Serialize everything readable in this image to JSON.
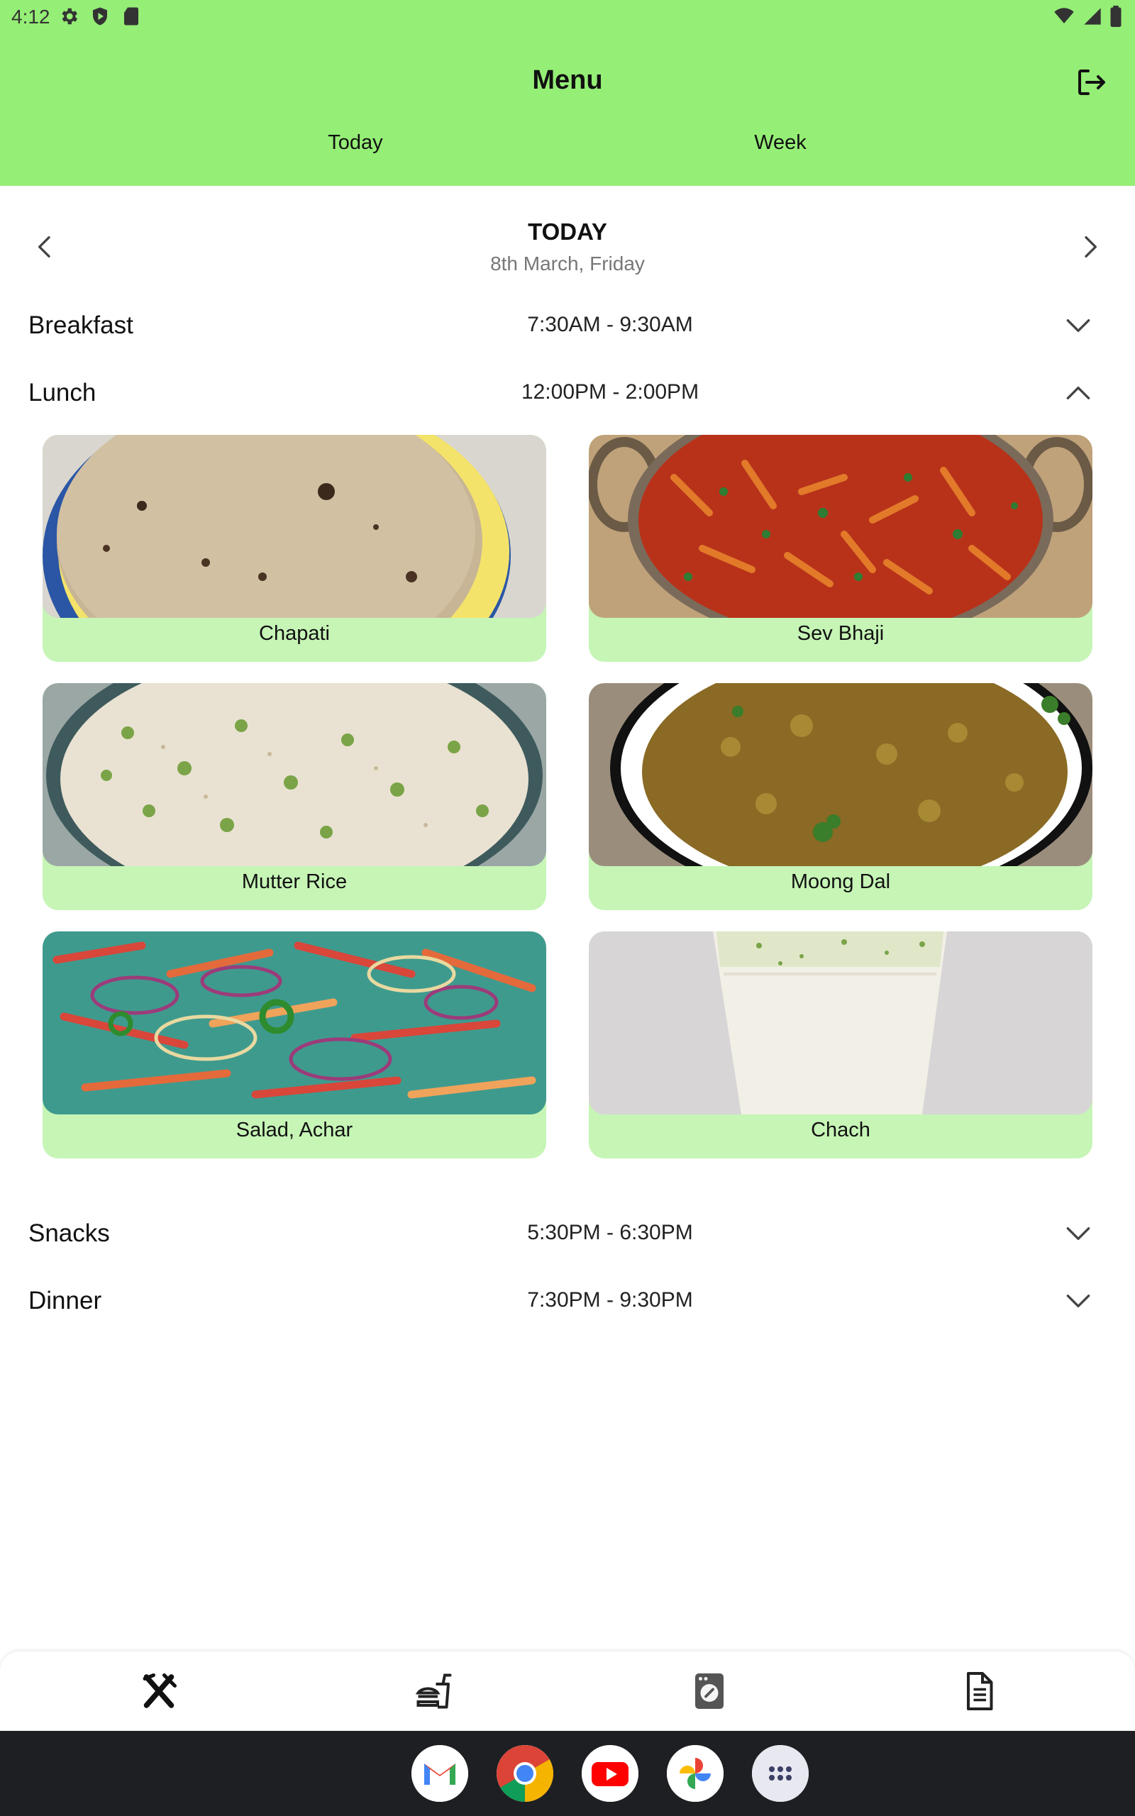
{
  "status_bar": {
    "time": "4:12"
  },
  "header": {
    "title": "Menu",
    "tabs": [
      {
        "label": "Today",
        "active": true
      },
      {
        "label": "Week",
        "active": false
      }
    ],
    "colors": {
      "header_bg": "#95ee76",
      "card_bg": "#c6f5b6"
    }
  },
  "date_nav": {
    "title": "TODAY",
    "subtitle": "8th March, Friday"
  },
  "meals": [
    {
      "name": "Breakfast",
      "time": "7:30AM - 9:30AM",
      "expanded": false
    },
    {
      "name": "Lunch",
      "time": "12:00PM - 2:00PM",
      "expanded": true,
      "items": [
        "Chapati",
        "Sev Bhaji",
        "Mutter Rice",
        "Moong Dal",
        "Salad, Achar",
        "Chach"
      ]
    },
    {
      "name": "Snacks",
      "time": "5:30PM - 6:30PM",
      "expanded": false
    },
    {
      "name": "Dinner",
      "time": "7:30PM - 9:30PM",
      "expanded": false
    }
  ],
  "bottom_nav": [
    {
      "icon": "utensils-icon",
      "selected": true
    },
    {
      "icon": "fast-food-icon",
      "selected": false
    },
    {
      "icon": "laundry-icon",
      "selected": false
    },
    {
      "icon": "document-icon",
      "selected": false
    }
  ],
  "dock": [
    "gmail-icon",
    "chrome-icon",
    "youtube-icon",
    "photos-icon",
    "app-drawer-icon"
  ]
}
